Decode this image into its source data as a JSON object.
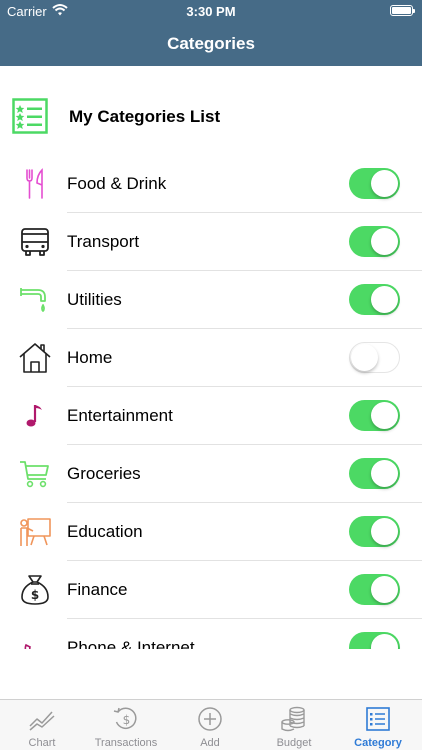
{
  "status_bar": {
    "carrier": "Carrier",
    "time": "3:30 PM"
  },
  "nav": {
    "title": "Categories"
  },
  "header": {
    "title": "My Categories List",
    "icon": "checklist-icon"
  },
  "categories": [
    {
      "label": "Food & Drink",
      "icon": "fork-knife-icon",
      "enabled": true
    },
    {
      "label": "Transport",
      "icon": "bus-icon",
      "enabled": true
    },
    {
      "label": "Utilities",
      "icon": "faucet-icon",
      "enabled": true
    },
    {
      "label": "Home",
      "icon": "house-icon",
      "enabled": false
    },
    {
      "label": "Entertainment",
      "icon": "music-note-icon",
      "enabled": true
    },
    {
      "label": "Groceries",
      "icon": "cart-icon",
      "enabled": true
    },
    {
      "label": "Education",
      "icon": "teacher-board-icon",
      "enabled": true
    },
    {
      "label": "Finance",
      "icon": "money-bag-icon",
      "enabled": true
    },
    {
      "label": "Phone & Internet",
      "icon": "phone-icon",
      "enabled": true
    }
  ],
  "tabs": [
    {
      "label": "Chart",
      "icon": "line-chart-icon",
      "active": false
    },
    {
      "label": "Transactions",
      "icon": "dollar-cycle-icon",
      "active": false
    },
    {
      "label": "Add",
      "icon": "plus-circle-icon",
      "active": false
    },
    {
      "label": "Budget",
      "icon": "coin-stack-icon",
      "active": false
    },
    {
      "label": "Category",
      "icon": "list-icon",
      "active": true
    }
  ],
  "colors": {
    "nav_bar": "#466b87",
    "toggle_on": "#4cd964",
    "tab_active": "#2f7bd6",
    "tab_inactive": "#8e8e93"
  }
}
